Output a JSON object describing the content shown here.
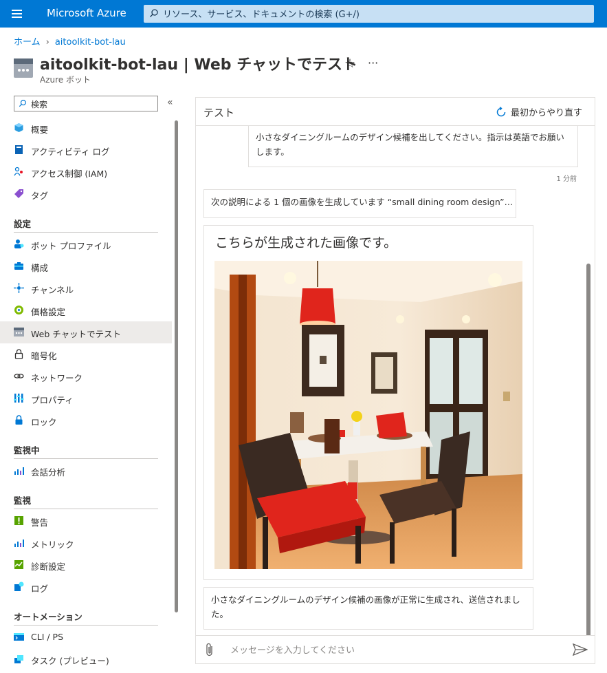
{
  "topbar": {
    "brand": "Microsoft Azure",
    "search_placeholder": "リソース、サービス、ドキュメントの検索 (G+/)"
  },
  "breadcrumb": {
    "home": "ホーム",
    "current": "aitoolkit-bot-lau"
  },
  "header": {
    "title": "aitoolkit-bot-lau | Web チャットでテスト",
    "subtitle": "Azure ボット",
    "star": "☆",
    "more": "···"
  },
  "nav": {
    "search_placeholder": "検索",
    "collapse": "«",
    "items_top": [
      "概要",
      "アクティビティ ログ",
      "アクセス制御 (IAM)",
      "タグ"
    ],
    "section_settings": "設定",
    "items_settings": [
      "ボット プロファイル",
      "構成",
      "チャンネル",
      "価格設定",
      "Web チャットでテスト",
      "暗号化",
      "ネットワーク",
      "プロパティ",
      "ロック"
    ],
    "section_monitoring_running": "監視中",
    "items_monitoring_running": [
      "会話分析"
    ],
    "section_monitoring": "監視",
    "items_monitoring": [
      "警告",
      "メトリック",
      "診断設定",
      "ログ"
    ],
    "section_automation": "オートメーション",
    "items_automation": [
      "CLI / PS",
      "タスク (プレビュー)"
    ]
  },
  "chat": {
    "title": "テスト",
    "restart_label": "最初からやり直す",
    "user_message": "小さなダイニングルームのデザイン候補を出してください。指示は英語でお願いします。",
    "timestamp": "1 分前",
    "bot_status": "次の説明による 1 個の画像を生成しています “small dining room design”…",
    "card_title": "こちらが生成された画像です。",
    "bot_final": "小さなダイニングルームのデザイン候補の画像が正常に生成され、送信されました。",
    "input_placeholder": "メッセージを入力してください"
  },
  "colors": {
    "topbar": "#0078d4",
    "search_bg": "#c7e0f4",
    "active_nav": "#edebe9",
    "link": "#0078d4"
  }
}
